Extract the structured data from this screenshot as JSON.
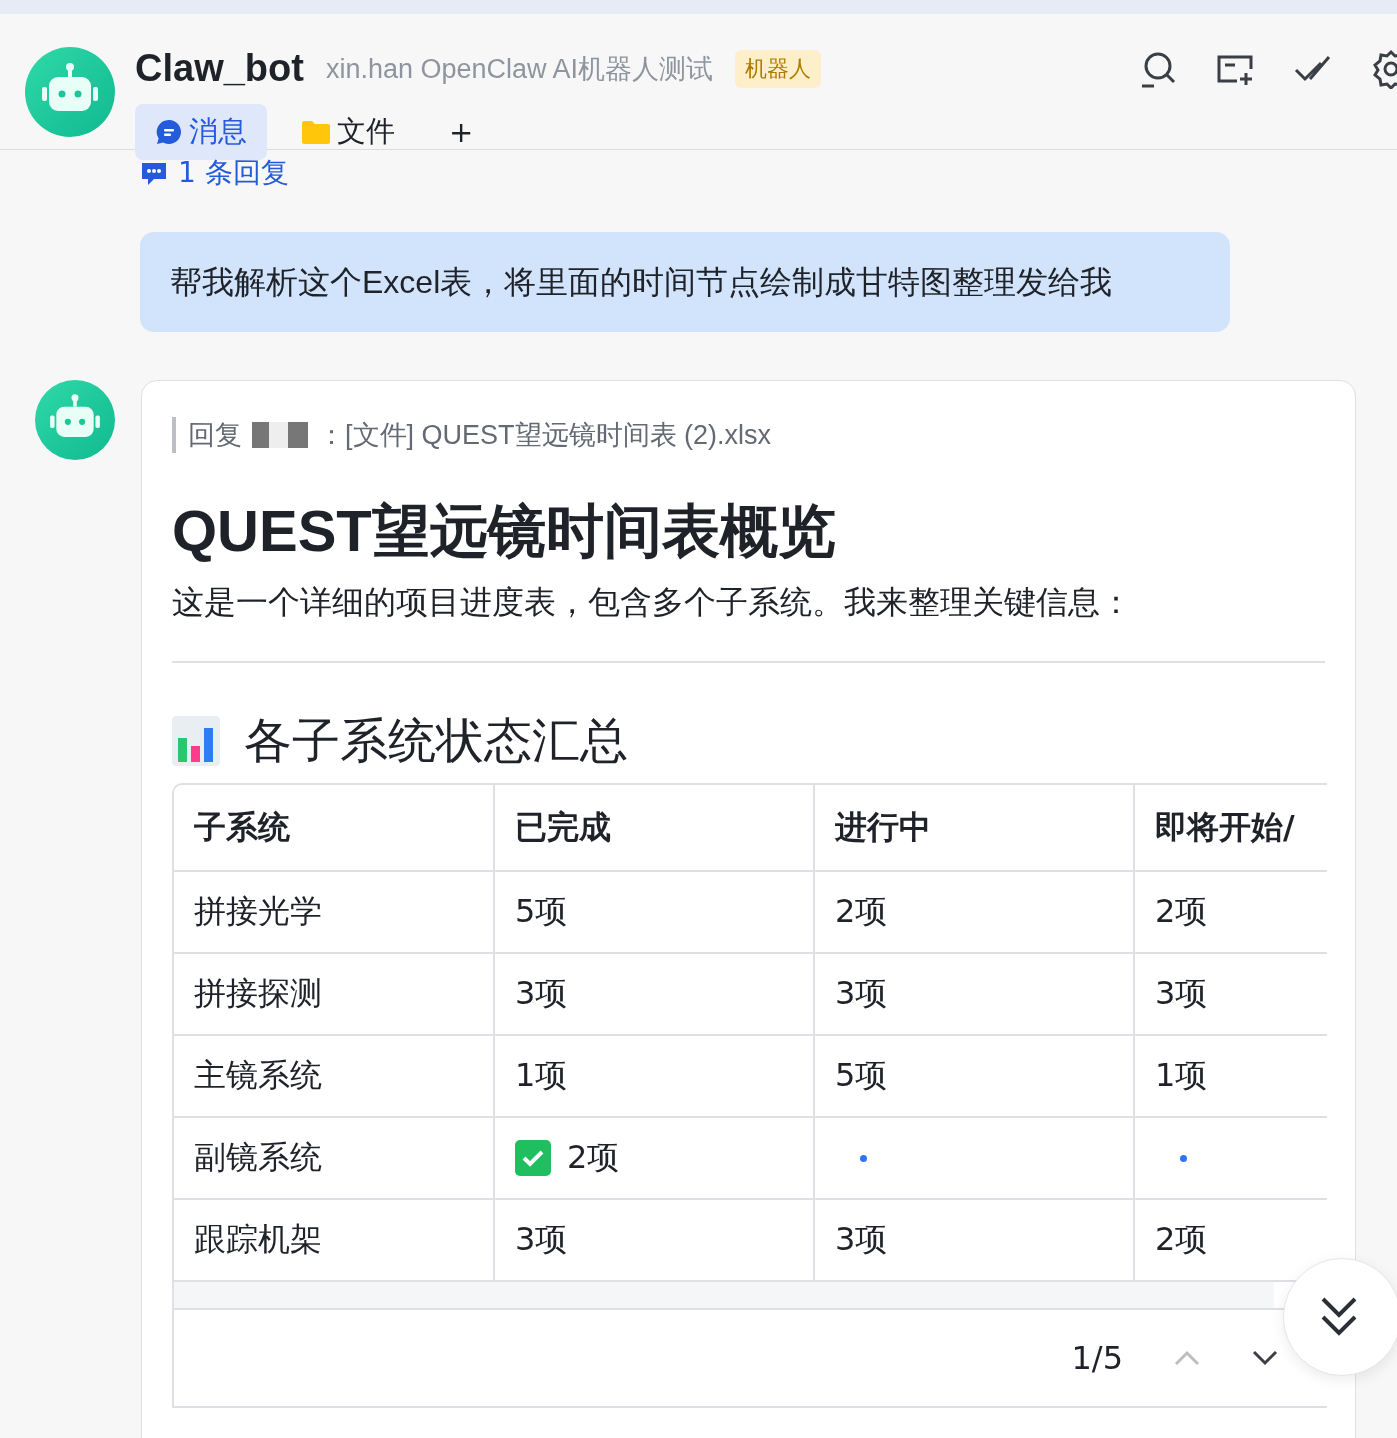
{
  "header": {
    "title": "Claw_bot",
    "subtitle": "xin.han OpenClaw AI机器人测试",
    "badge": "机器人"
  },
  "tabs": [
    {
      "label": "消息",
      "kind": "chat",
      "selected": true
    },
    {
      "label": "文件",
      "kind": "folder",
      "selected": false
    },
    {
      "label": "+",
      "kind": "add",
      "selected": false
    }
  ],
  "thread": {
    "replies": "1 条回复"
  },
  "user_message": "帮我解析这个Excel表，将里面的时间节点绘制成甘特图整理发给我",
  "bot_message": {
    "reply_label": "回复",
    "reply_quote": "：[文件] QUEST望远镜时间表 (2).xlsx",
    "title": "QUEST望远镜时间表概览",
    "intro": "这是一个详细的项目进度表，包含多个子系统。我来整理关键信息：",
    "section": "各子系统状态汇总",
    "table": {
      "columns": [
        "子系统",
        "已完成",
        "进行中",
        "即将开始/"
      ],
      "rows": [
        [
          {
            "kind": "text",
            "text": "拼接光学"
          },
          {
            "kind": "text",
            "text": "5项"
          },
          {
            "kind": "text",
            "text": "2项"
          },
          {
            "kind": "text",
            "text": "2项"
          }
        ],
        [
          {
            "kind": "text",
            "text": "拼接探测"
          },
          {
            "kind": "text",
            "text": "3项"
          },
          {
            "kind": "text",
            "text": "3项"
          },
          {
            "kind": "text",
            "text": "3项"
          }
        ],
        [
          {
            "kind": "text",
            "text": "主镜系统"
          },
          {
            "kind": "text",
            "text": "1项"
          },
          {
            "kind": "text",
            "text": "5项"
          },
          {
            "kind": "text",
            "text": "1项"
          }
        ],
        [
          {
            "kind": "text",
            "text": "副镜系统"
          },
          {
            "kind": "check",
            "text": "2项"
          },
          {
            "kind": "bullet"
          },
          {
            "kind": "bullet"
          }
        ],
        [
          {
            "kind": "text",
            "text": "跟踪机架"
          },
          {
            "kind": "text",
            "text": "3项"
          },
          {
            "kind": "text",
            "text": "3项"
          },
          {
            "kind": "text",
            "text": "2项"
          }
        ]
      ]
    },
    "pager": "1/5"
  }
}
